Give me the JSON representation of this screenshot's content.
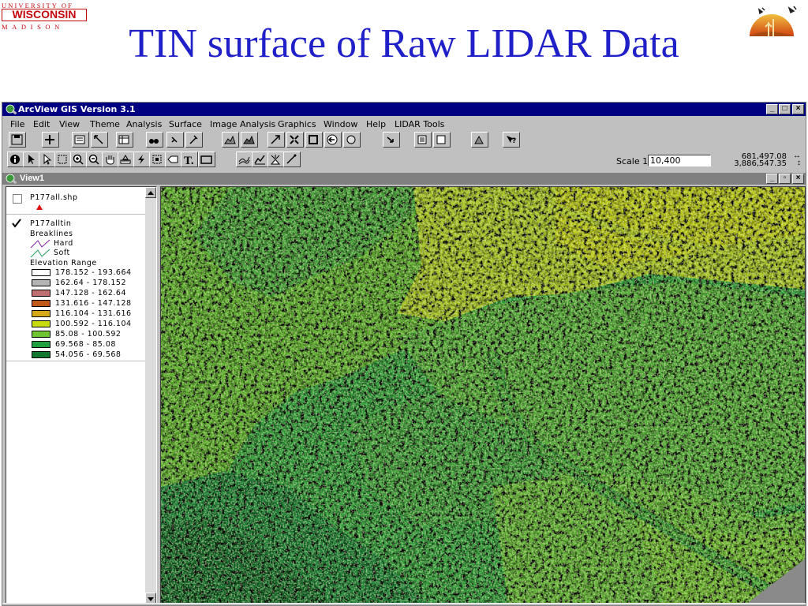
{
  "slide": {
    "logo_line1": "UNIVERSITY OF",
    "logo_line2": "WISCONSIN",
    "logo_line3": "MADISON",
    "title": "TIN surface of Raw LIDAR Data"
  },
  "window": {
    "title": "ArcView GIS Version 3.1",
    "controls": [
      "_",
      "□",
      "×"
    ]
  },
  "menu": [
    "File",
    "Edit",
    "View",
    "Theme",
    "Analysis",
    "Surface",
    "Image Analysis",
    "Graphics",
    "Window",
    "Help",
    "LIDAR Tools"
  ],
  "toolbar": {
    "scale_label": "Scale 1:",
    "scale_value": "10,400",
    "coord_x": "681,497.08",
    "coord_y": "3,886,547.35"
  },
  "view": {
    "title": "View1"
  },
  "legend": {
    "theme1": {
      "name": "P177all.shp",
      "checked": false
    },
    "theme2": {
      "name": "P177alltin",
      "checked": true,
      "breaklines_label": "Breaklines",
      "hard_label": "Hard",
      "soft_label": "Soft",
      "elevation_label": "Elevation Range",
      "ranges": [
        {
          "label": "178.152 - 193.664",
          "color": "#ffffff"
        },
        {
          "label": "162.64 - 178.152",
          "color": "#b4b4b4"
        },
        {
          "label": "147.128 - 162.64",
          "color": "#c07070"
        },
        {
          "label": "131.616 - 147.128",
          "color": "#c05a1a"
        },
        {
          "label": "116.104 - 131.616",
          "color": "#d4a818"
        },
        {
          "label": "100.592 - 116.104",
          "color": "#c8dc10"
        },
        {
          "label": "85.08 - 100.592",
          "color": "#6cc430"
        },
        {
          "label": "69.568 - 85.08",
          "color": "#20a040"
        },
        {
          "label": "54.056 - 69.568",
          "color": "#107830"
        }
      ]
    }
  },
  "colors": {
    "title_blue": "#2020c8",
    "uw_red": "#c5050c",
    "titlebar": "#000080"
  }
}
